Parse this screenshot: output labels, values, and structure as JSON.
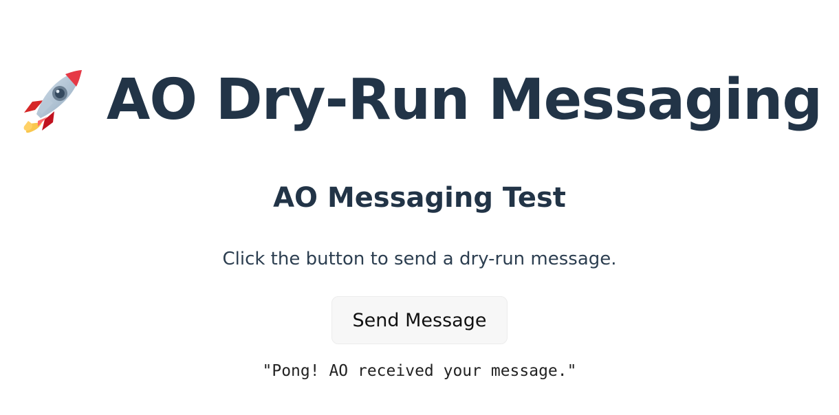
{
  "header": {
    "icon_name": "rocket-icon",
    "title": "AO Dry-Run Messaging"
  },
  "main": {
    "heading": "AO Messaging Test",
    "description": "Click the button to send a dry-run message.",
    "button_label": "Send Message",
    "response_text": "\"Pong! AO received your message.\""
  },
  "theme": {
    "heading_color": "#223447",
    "button_background": "#F7F7F7"
  }
}
